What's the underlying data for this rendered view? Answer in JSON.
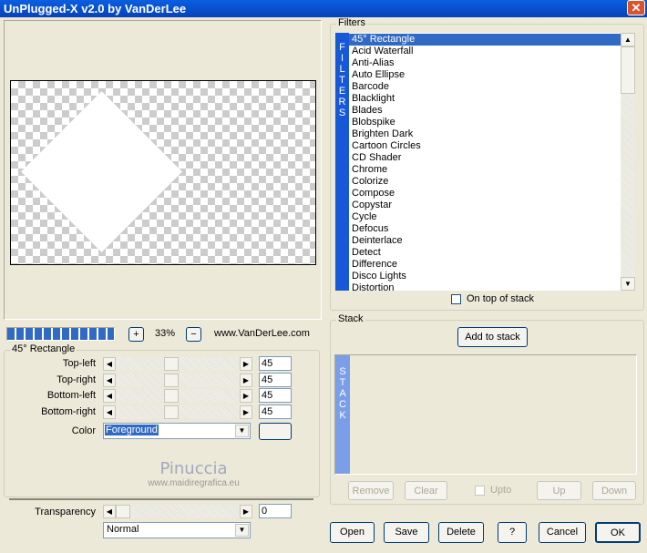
{
  "window": {
    "title": "UnPlugged-X v2.0 by VanDerLee",
    "close_icon": "close-icon"
  },
  "preview": {
    "zoom": "33%",
    "zoom_in": "+",
    "zoom_out": "−",
    "website": "www.VanDerLee.com",
    "progress_percent": 100
  },
  "params": {
    "group_title": "45° Rectangle",
    "sliders": [
      {
        "label": "Top-left",
        "value": "45"
      },
      {
        "label": "Top-right",
        "value": "45"
      },
      {
        "label": "Bottom-left",
        "value": "45"
      },
      {
        "label": "Bottom-right",
        "value": "45"
      }
    ],
    "color_label": "Color",
    "color_value": "Foreground",
    "watermark": {
      "name": "Pinuccia",
      "url": "www.maidiregrafica.eu"
    },
    "transparency_label": "Transparency",
    "transparency_value": "0",
    "blend_mode": "Normal"
  },
  "filters": {
    "title": "Filters",
    "strip": "FILTERS",
    "items": [
      "45° Rectangle",
      "Acid Waterfall",
      "Anti-Alias",
      "Auto Ellipse",
      "Barcode",
      "Blacklight",
      "Blades",
      "Blobspike",
      "Brighten Dark",
      "Cartoon Circles",
      "CD Shader",
      "Chrome",
      "Colorize",
      "Compose",
      "Copystar",
      "Cycle",
      "Defocus",
      "Deinterlace",
      "Detect",
      "Difference",
      "Disco Lights",
      "Distortion"
    ],
    "selected": "45° Rectangle",
    "on_top_label": "On top of stack"
  },
  "stack": {
    "title": "Stack",
    "strip": "STACK",
    "add": "Add to stack",
    "remove": "Remove",
    "clear": "Clear",
    "upto": "Upto",
    "up": "Up",
    "down": "Down"
  },
  "footer": {
    "open": "Open",
    "save": "Save",
    "delete": "Delete",
    "help": "?",
    "cancel": "Cancel",
    "ok": "OK"
  }
}
